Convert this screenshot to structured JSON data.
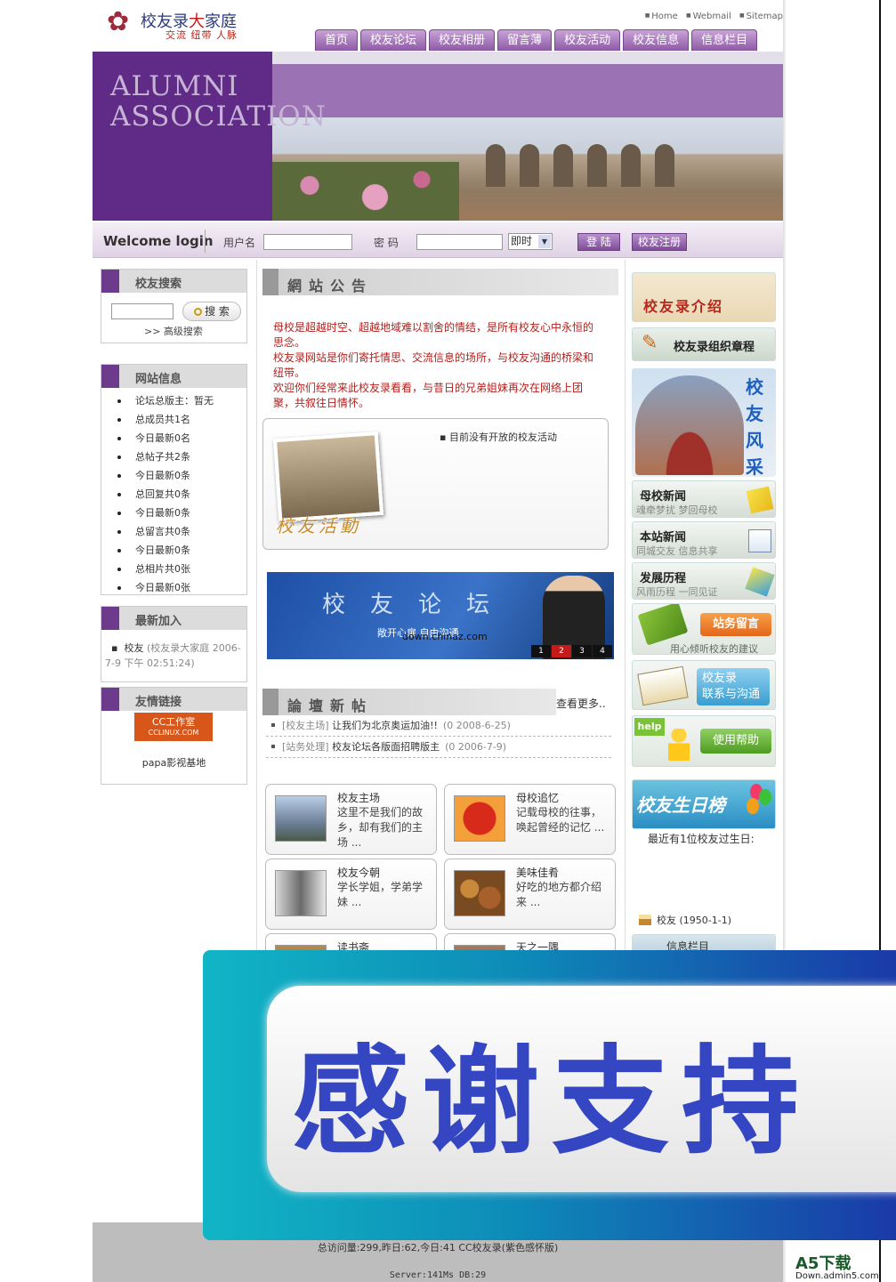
{
  "header": {
    "logo_title_a": "校友录",
    "logo_title_hl": "大",
    "logo_title_b": "家庭",
    "logo_sub": "交流 纽带 人脉",
    "toplinks": [
      "Home",
      "Webmail",
      "Sitemap"
    ],
    "nav": [
      "首页",
      "校友论坛",
      "校友相册",
      "留言薄",
      "校友活动",
      "校友信息",
      "信息栏目"
    ]
  },
  "banner": {
    "text_line1": "ALUMNI",
    "text_line2": "ASSOCIATION"
  },
  "login": {
    "title": "Welcome login",
    "user_label": "用户名",
    "pass_label": "密 码",
    "mode_value": "即时",
    "login_button": "登 陆",
    "register_button": "校友注册"
  },
  "left": {
    "search": {
      "title": "校友搜索",
      "button": "搜 索",
      "advanced": ">> 高级搜索"
    },
    "site_info": {
      "title": "网站信息",
      "items": [
        "论坛总版主：暂无",
        "总成员共1名",
        "今日最新0名",
        "总帖子共2条",
        "今日最新0条",
        "总回复共0条",
        "今日最新0条",
        "总留言共0条",
        "今日最新0条",
        "总相片共0张",
        "今日最新0张"
      ]
    },
    "newest": {
      "title": "最新加入",
      "name": "校友",
      "detail": "(校友录大家庭 2006-7-9 下午 02:51:24)"
    },
    "links": {
      "title": "友情链接",
      "logo_text": "CC工作室",
      "logo_sub": "CCLINUX.COM",
      "item": "papa影视基地"
    }
  },
  "middle": {
    "notice": {
      "title": "網站公告",
      "lines": [
        "母校是超越时空、超越地域难以割舍的情结，是所有校友心中永恒的思念。",
        "校友录网站是你们寄托情思、交流信息的场所，与校友沟通的桥梁和纽带。",
        "欢迎你们经常来此校友录看看，与昔日的兄弟姐妹再次在网络上团聚，共叙往日情怀。"
      ]
    },
    "activity": {
      "label": "校友活動",
      "empty_text": "目前没有开放的校友活动"
    },
    "forum_banner": {
      "title": "校友论坛",
      "sub": "敞开心扉 自由沟通",
      "url": "down.chinaz.com",
      "pages": [
        "1",
        "2",
        "3",
        "4"
      ]
    },
    "posts": {
      "title": "論壇新帖",
      "more": "查看更多..",
      "items": [
        {
          "cat": "[校友主场]",
          "title": "让我们为北京奥运加油!!",
          "date": "(0 2008-6-25)"
        },
        {
          "cat": "[站务处理]",
          "title": "校友论坛各版面招聘版主",
          "date": "(0 2006-7-9)"
        }
      ]
    },
    "tiles": [
      {
        "title": "校友主场",
        "desc": "这里不是我们的故乡，却有我们的主场 ..."
      },
      {
        "title": "母校追忆",
        "desc": "记载母校的往事，唤起曾经的记忆 ..."
      },
      {
        "title": "校友今朝",
        "desc": "学长学姐，学弟学妹 ..."
      },
      {
        "title": "美味佳肴",
        "desc": "好吃的地方都介绍来 ..."
      },
      {
        "title": "读书斋",
        "desc": ""
      },
      {
        "title": "天之一隅",
        "desc": ""
      }
    ]
  },
  "right": {
    "intro": "校友录介绍",
    "charter": "校友录组织章程",
    "fengcai": "校友风采",
    "news": [
      {
        "title": "母校新闻",
        "sub": "魂牵梦扰  梦回母校"
      },
      {
        "title": "本站新闻",
        "sub": "同城交友  信息共享"
      },
      {
        "title": "发展历程",
        "sub": "风雨历程  一同见证"
      }
    ],
    "message_button": "站务留言",
    "message_sub": "用心倾听校友的建议",
    "contact_line1": "校友录",
    "contact_line2": "联系与沟通",
    "help_tag": "help",
    "help_button": "使用帮助",
    "birthday_title": "校友生日榜",
    "birthday_text": "最近有1位校友过生日:",
    "birthday_item": "校友 (1950-1-1)",
    "info_column": "信息栏目"
  },
  "footer": {
    "line1": "总访问量:299,昨日:62,今日:41 CC校友录(紫色感怀版)",
    "line2": "Server:141Ms  DB:29"
  },
  "overlay_ad": {
    "text": "感谢支持"
  },
  "watermark": {
    "line1": "A5下载",
    "line2": "Down.admin5.com"
  }
}
